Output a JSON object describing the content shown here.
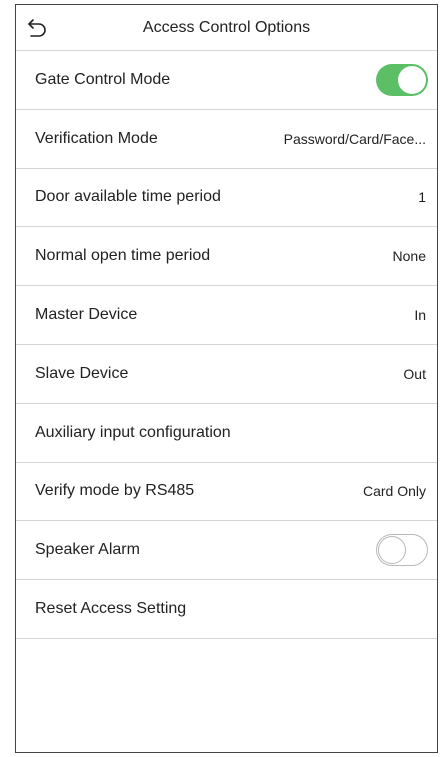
{
  "header": {
    "title": "Access Control Options",
    "back_icon": "back-arrow-icon"
  },
  "rows": [
    {
      "label": "Gate Control Mode",
      "value": "",
      "toggle": "on"
    },
    {
      "label": "Verification Mode",
      "value": "Password/Card/Face..."
    },
    {
      "label": "Door available time period",
      "value": "1"
    },
    {
      "label": "Normal open time period",
      "value": "None"
    },
    {
      "label": "Master Device",
      "value": "In"
    },
    {
      "label": "Slave Device",
      "value": "Out"
    },
    {
      "label": "Auxiliary input configuration",
      "value": ""
    },
    {
      "label": "Verify mode by RS485",
      "value": "Card Only"
    },
    {
      "label": "Speaker Alarm",
      "value": "",
      "toggle": "off"
    },
    {
      "label": "Reset Access Setting",
      "value": ""
    }
  ],
  "colors": {
    "toggle_on": "#5cbf65",
    "divider": "#d5d5d5",
    "text": "#222222"
  }
}
